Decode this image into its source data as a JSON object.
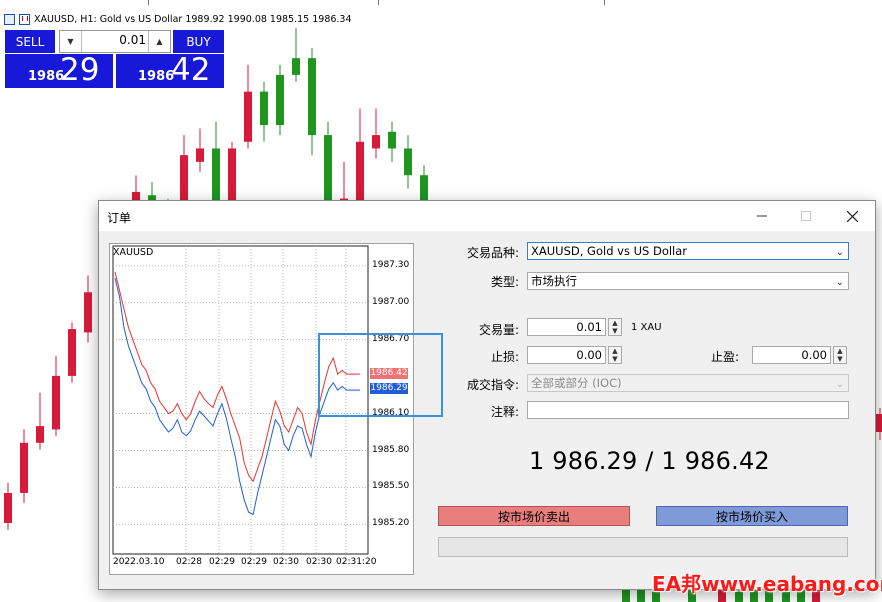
{
  "chart": {
    "symbol_header": "XAUUSD, H1:  Gold vs US Dollar  1989.92 1990.08 1985.15 1986.34"
  },
  "one_click": {
    "sell_label": "SELL",
    "buy_label": "BUY",
    "lot": "0.01",
    "sell_price_small": "1986",
    "sell_price_big": "29",
    "buy_price_small": "1986",
    "buy_price_big": "42"
  },
  "dialog": {
    "title": "订单",
    "mini_chart": {
      "symbol": "XAUUSD",
      "y_ticks": [
        "1987.30",
        "1987.00",
        "1986.70",
        "1986.10",
        "1985.80",
        "1985.50",
        "1985.20"
      ],
      "x_ticks": [
        "2022.03.10",
        "02:28",
        "02:29",
        "02:29",
        "02:30",
        "02:30",
        "02:31:20"
      ],
      "ask_tag": "1986.42",
      "bid_tag": "1986.29"
    },
    "symbol_label": "交易品种:",
    "symbol_value": "XAUUSD, Gold vs US Dollar",
    "type_label": "类型:",
    "type_value": "市场执行",
    "volume_label": "交易量:",
    "volume_value": "0.01",
    "volume_unit": "1 XAU",
    "sl_label": "止损:",
    "sl_value": "0.00",
    "tp_label": "止盈:",
    "tp_value": "0.00",
    "fill_label": "成交指令:",
    "fill_value": "全部或部分 (IOC)",
    "comment_label": "注释:",
    "comment_value": "",
    "price_display": "1 986.29 / 1 986.42",
    "sell_button": "按市场价卖出",
    "buy_button": "按市场价买入"
  },
  "watermark": "EA邦www.eabang.com",
  "colors": {
    "bull_candle": "#1e9620",
    "bear_candle": "#d81b3a",
    "oct_blue": "#1818d8",
    "ask_line": "#e8332e",
    "bid_line": "#1f5ed8",
    "highlight_box": "#3a8fde"
  },
  "candles": [
    {
      "open": 1990.6,
      "close": 1991.5,
      "high": 1991.8,
      "low": 1990.4,
      "dir": "bear"
    },
    {
      "open": 1991.5,
      "close": 1993.0,
      "high": 1993.4,
      "low": 1991.2,
      "dir": "bear"
    },
    {
      "open": 1993.0,
      "close": 1993.5,
      "high": 1994.5,
      "low": 1992.8,
      "dir": "bear"
    },
    {
      "open": 1993.4,
      "close": 1995.0,
      "high": 1995.6,
      "low": 1993.2,
      "dir": "bear"
    },
    {
      "open": 1995.0,
      "close": 1996.4,
      "high": 1996.6,
      "low": 1994.8,
      "dir": "bear"
    },
    {
      "open": 1996.3,
      "close": 1997.5,
      "high": 1998.0,
      "low": 1996.0,
      "dir": "bear"
    },
    {
      "open": 1997.4,
      "close": 1997.8,
      "high": 1998.5,
      "low": 1997.0,
      "dir": "bear"
    },
    {
      "open": 1997.6,
      "close": 1999.4,
      "high": 1999.8,
      "low": 1997.4,
      "dir": "bear"
    },
    {
      "open": 1999.2,
      "close": 2000.5,
      "high": 2001.0,
      "low": 1999.0,
      "dir": "bear"
    },
    {
      "open": 2000.4,
      "close": 2000.0,
      "high": 2000.8,
      "low": 1999.6,
      "dir": "bull"
    },
    {
      "open": 2000.0,
      "close": 1999.5,
      "high": 2000.3,
      "low": 1999.4,
      "dir": "bull"
    },
    {
      "open": 1999.5,
      "close": 2001.6,
      "high": 2002.2,
      "low": 1999.4,
      "dir": "bear"
    },
    {
      "open": 2001.4,
      "close": 2001.8,
      "high": 2002.4,
      "low": 2001.1,
      "dir": "bear"
    },
    {
      "open": 2001.8,
      "close": 2000.0,
      "high": 2002.6,
      "low": 1999.8,
      "dir": "bull"
    },
    {
      "open": 2000.0,
      "close": 2001.8,
      "high": 2002.0,
      "low": 1999.7,
      "dir": "bear"
    },
    {
      "open": 2002.0,
      "close": 2003.5,
      "high": 2004.3,
      "low": 2001.8,
      "dir": "bear"
    },
    {
      "open": 2003.5,
      "close": 2002.5,
      "high": 2003.8,
      "low": 2002.0,
      "dir": "bull"
    },
    {
      "open": 2002.5,
      "close": 2004.0,
      "high": 2004.3,
      "low": 2002.2,
      "dir": "bull"
    },
    {
      "open": 2004.0,
      "close": 2004.5,
      "high": 2005.4,
      "low": 2003.8,
      "dir": "bull"
    },
    {
      "open": 2004.5,
      "close": 2002.2,
      "high": 2004.8,
      "low": 2001.6,
      "dir": "bull"
    },
    {
      "open": 2002.2,
      "close": 1999.4,
      "high": 2002.6,
      "low": 1999.0,
      "dir": "bull"
    },
    {
      "open": 1999.4,
      "close": 2000.3,
      "high": 2001.4,
      "low": 1999.1,
      "dir": "bear"
    },
    {
      "open": 2000.2,
      "close": 2002.0,
      "high": 2003.0,
      "low": 1999.8,
      "dir": "bear"
    },
    {
      "open": 2001.8,
      "close": 2002.2,
      "high": 2003.0,
      "low": 2001.5,
      "dir": "bear"
    },
    {
      "open": 2002.3,
      "close": 2001.8,
      "high": 2002.6,
      "low": 2001.4,
      "dir": "bull"
    },
    {
      "open": 2001.8,
      "close": 2001.0,
      "high": 2002.2,
      "low": 2000.6,
      "dir": "bull"
    },
    {
      "open": 2001.0,
      "close": 1999.4,
      "high": 2001.3,
      "low": 1999.0,
      "dir": "bull"
    }
  ],
  "mini_ask": [
    1987.25,
    1987.1,
    1986.95,
    1986.8,
    1986.7,
    1986.6,
    1986.5,
    1986.45,
    1986.35,
    1986.3,
    1986.2,
    1986.15,
    1986.1,
    1986.12,
    1986.18,
    1986.1,
    1986.05,
    1986.1,
    1986.2,
    1986.28,
    1986.22,
    1986.18,
    1986.15,
    1986.25,
    1986.32,
    1986.22,
    1986.1,
    1986.0,
    1985.9,
    1985.7,
    1985.6,
    1985.55,
    1985.65,
    1985.75,
    1985.9,
    1986.05,
    1986.2,
    1986.12,
    1986.0,
    1985.95,
    1986.05,
    1986.15,
    1986.1,
    1985.95,
    1985.85,
    1986.05,
    1986.2,
    1986.35,
    1986.48,
    1986.55,
    1986.42,
    1986.45,
    1986.42,
    1986.42,
    1986.42,
    1986.42
  ],
  "mini_bid": [
    1987.2,
    1987.05,
    1986.8,
    1986.65,
    1986.55,
    1986.45,
    1986.35,
    1986.3,
    1986.2,
    1986.15,
    1986.05,
    1986.0,
    1985.95,
    1985.98,
    1986.05,
    1985.95,
    1985.92,
    1985.96,
    1986.05,
    1986.12,
    1986.08,
    1986.04,
    1986.0,
    1986.1,
    1986.18,
    1986.06,
    1985.9,
    1985.75,
    1985.55,
    1985.4,
    1985.3,
    1985.28,
    1985.45,
    1985.6,
    1985.75,
    1985.9,
    1986.05,
    1986.0,
    1985.85,
    1985.8,
    1985.92,
    1986.0,
    1985.98,
    1985.85,
    1985.75,
    1985.95,
    1986.1,
    1986.2,
    1986.3,
    1986.35,
    1986.29,
    1986.32,
    1986.29,
    1986.29,
    1986.29,
    1986.29
  ]
}
